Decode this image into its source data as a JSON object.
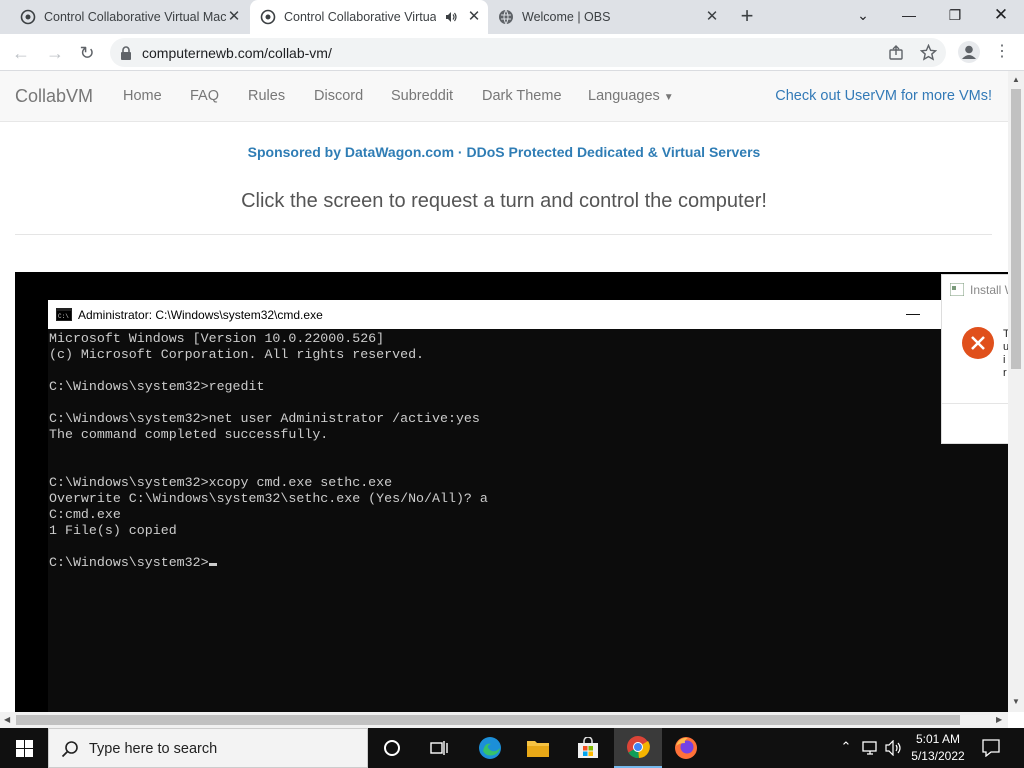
{
  "browser": {
    "tabs": [
      {
        "title": "Control Collaborative Virtual Machines",
        "active": false
      },
      {
        "title": "Control Collaborative Virtual Machines",
        "active": true
      },
      {
        "title": "Welcome | OBS",
        "active": false
      }
    ],
    "url": "computernewb.com/collab-vm/"
  },
  "site": {
    "brand": "CollabVM",
    "nav": [
      "Home",
      "FAQ",
      "Rules",
      "Discord",
      "Subreddit",
      "Dark Theme",
      "Languages"
    ],
    "uservm_link": "Check out UserVM for more VMs!",
    "sponsor": "Sponsored by DataWagon.com · DDoS Protected Dedicated & Virtual Servers",
    "prompt": "Click the screen to request a turn and control the computer!"
  },
  "vm": {
    "cmd_title": "Administrator: C:\\Windows\\system32\\cmd.exe",
    "cmd_lines": [
      "Microsoft Windows [Version 10.0.22000.526]",
      "(c) Microsoft Corporation. All rights reserved.",
      "",
      "C:\\Windows\\system32>regedit",
      "",
      "C:\\Windows\\system32>net user Administrator /active:yes",
      "The command completed successfully.",
      "",
      "",
      "C:\\Windows\\system32>xcopy cmd.exe sethc.exe",
      "Overwrite C:\\Windows\\system32\\sethc.exe (Yes/No/All)? a",
      "C:cmd.exe",
      "1 File(s) copied",
      "",
      "C:\\Windows\\system32>"
    ],
    "install_title": "Install W",
    "install_letters": [
      "T",
      "u",
      "i",
      "r"
    ]
  },
  "taskbar": {
    "search_placeholder": "Type here to search",
    "time": "5:01 AM",
    "date": "5/13/2022"
  },
  "colors": {
    "link": "#337ab7",
    "sponsor": "#2f7db5",
    "taskbar": "#101010",
    "error": "#e0501c"
  }
}
